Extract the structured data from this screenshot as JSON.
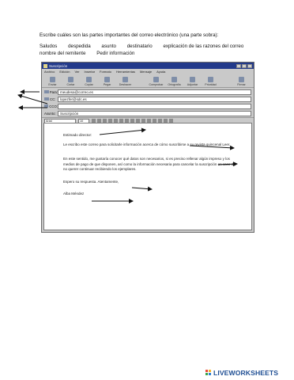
{
  "instruction": "Escribe cuáles son las partes importantes del correo electrónico (una parte sobra):",
  "word_bank": [
    "Saludos",
    "despedida",
    "asunto",
    "destinatario",
    "explicación de las razones del correo",
    "nombre del remitente",
    "Pedir información"
  ],
  "window": {
    "title": "Suscripción",
    "menu": [
      "Archivo",
      "Edición",
      "Ver",
      "Insertar",
      "Formato",
      "Herramientas",
      "Mensaje",
      "Ayuda"
    ],
    "toolbar": [
      "Enviar",
      "Cortar",
      "Copiar",
      "Pegar",
      "Deshacer",
      "Comprobar",
      "Ortografía",
      "Adjuntar",
      "Prioridad",
      "Firmar"
    ],
    "fields": {
      "to_label": "Para:",
      "to_value": "meudesa@correo.es",
      "cc_label": "CC:",
      "cc_value": "lopezfer@sdc.es",
      "bcc_label": "CCO:",
      "bcc_value": "",
      "subject_label": "Asunto:",
      "subject_value": "Suscripción"
    },
    "format": {
      "font": "Arial",
      "size": "10"
    },
    "body": {
      "greeting": "Estimado director:",
      "para1": "Le escribo este correo para solicitarle información acerca de cómo suscribirse a su revista quincenal Leer.",
      "para2": "En este sentido, me gustaría conocer qué datos son necesarios, si es preciso rellenar algún impreso y los medios de pago de que disponen, así como la información necesaria para cancelar la suscripción en caso de no querer continuar recibiendo los ejemplares.",
      "closing": "Espero su respuesta. Atentamente,",
      "signature": "Alba Méndez"
    }
  },
  "logo": "LIVEWORKSHEETS",
  "colors": {
    "titlebar": "#233a8a",
    "logo": "#1d4d93"
  }
}
